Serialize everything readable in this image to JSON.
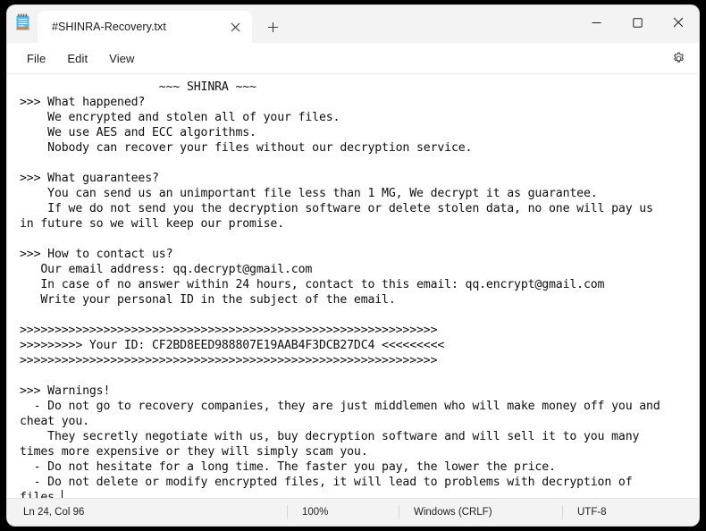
{
  "window": {
    "app_name": "Notepad",
    "icon": "notepad-icon",
    "controls": {
      "minimize": "minimize-icon",
      "maximize": "maximize-icon",
      "close": "close-icon"
    }
  },
  "tabs": [
    {
      "label": "#SHINRA-Recovery.txt",
      "close_icon": "close-icon",
      "active": true
    }
  ],
  "new_tab": {
    "icon": "plus-icon",
    "label": "+"
  },
  "menu": {
    "items": [
      {
        "label": "File"
      },
      {
        "label": "Edit"
      },
      {
        "label": "View"
      }
    ],
    "settings": {
      "icon": "gear-icon"
    }
  },
  "editor": {
    "content": "                    ~~~ SHINRA ~~~\n>>> What happened?\n    We encrypted and stolen all of your files.\n    We use AES and ECC algorithms.\n    Nobody can recover your files without our decryption service.\n\n>>> What guarantees?\n    You can send us an unimportant file less than 1 MG, We decrypt it as guarantee.\n    If we do not send you the decryption software or delete stolen data, no one will pay us in future so we will keep our promise.\n\n>>> How to contact us?\n   Our email address: qq.decrypt@gmail.com\n   In case of no answer within 24 hours, contact to this email: qq.encrypt@gmail.com\n   Write your personal ID in the subject of the email.\n\n>>>>>>>>>>>>>>>>>>>>>>>>>>>>>>>>>>>>>>>>>>>>>>>>>>>>>>>>>>>>\n>>>>>>>>> Your ID: CF2BD8EED988807E19AAB4F3DCB27DC4 <<<<<<<<<\n>>>>>>>>>>>>>>>>>>>>>>>>>>>>>>>>>>>>>>>>>>>>>>>>>>>>>>>>>>>>\n\n>>> Warnings!\n  - Do not go to recovery companies, they are just middlemen who will make money off you and cheat you.\n    They secretly negotiate with us, buy decryption software and will sell it to you many times more expensive or they will simply scam you.\n  - Do not hesitate for a long time. The faster you pay, the lower the price.\n  - Do not delete or modify encrypted files, it will lead to problems with decryption of files.",
    "header": "~~~ SHINRA ~~~",
    "personal_id": "CF2BD8EED988807E19AAB4F3DCB27DC4",
    "emails": [
      "qq.decrypt@gmail.com",
      "qq.encrypt@gmail.com"
    ],
    "caret_visible": true
  },
  "statusbar": {
    "position": "Ln 24, Col 96",
    "zoom": "100%",
    "line_ending": "Windows (CRLF)",
    "encoding": "UTF-8"
  }
}
